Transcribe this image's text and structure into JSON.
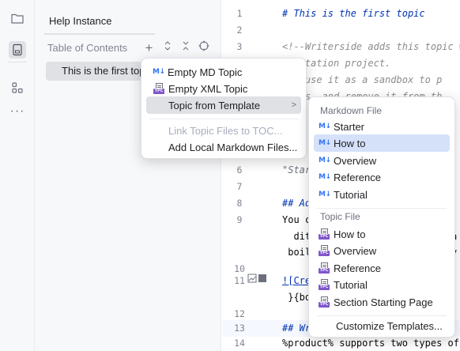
{
  "toolstrip": {
    "icons": [
      "folder-icon",
      "documents-icon",
      "structure-icon",
      "more-icon"
    ],
    "more_label": "···"
  },
  "panel": {
    "title": "Help Instance",
    "toc_label": "Table of Contents",
    "actions": {
      "add": "+",
      "expand": "⌃",
      "collapse": "✕",
      "locate": "⊕"
    },
    "selected_topic": "This is the first top"
  },
  "editor": {
    "lines": [
      {
        "n": "1",
        "t": "# This is the first topic"
      },
      {
        "n": "2",
        "t": ""
      },
      {
        "n": "3",
        "t": "<!--Writerside adds this topic w"
      },
      {
        "n": "",
        "t": "umentation project."
      },
      {
        "n": "",
        "t": "can use it as a sandbox to p"
      },
      {
        "n": "",
        "t": "tures, and remove it from th"
      },
      {
        "n": "",
        "t": "u"
      },
      {
        "n": "",
        "t": "e"
      },
      {
        "n": "6",
        "t": "\"Star"
      },
      {
        "n": "7",
        "t": ""
      },
      {
        "n": "8",
        "t": "## Ad"
      },
      {
        "n": "9",
        "t": "You c"
      },
      {
        "n": "",
        "t": "  dit"
      },
      {
        "n": "",
        "t": " boil"
      },
      {
        "n": "10",
        "t": ""
      },
      {
        "n": "11",
        "t": "![Cre"
      },
      {
        "n": "",
        "t": " }{bo"
      },
      {
        "n": "12",
        "t": ""
      },
      {
        "n": "13",
        "t": "## Wr"
      },
      {
        "n": "14",
        "t": "%product% supports two types of"
      }
    ],
    "right_edge": [
      ")",
      "a",
      "y"
    ]
  },
  "menu1": {
    "items": [
      {
        "label": "Empty MD Topic",
        "icon": "markdown-icon",
        "enabled": true
      },
      {
        "label": "Empty XML Topic",
        "icon": "tpc-icon",
        "enabled": true
      },
      {
        "label": "Topic from Template",
        "icon": "",
        "enabled": true,
        "submenu": true
      },
      {
        "label": "Link Topic Files to TOC...",
        "icon": "",
        "enabled": false
      },
      {
        "label": "Add Local Markdown Files...",
        "icon": "",
        "enabled": true
      }
    ],
    "submenu_arrow": ">"
  },
  "menu2": {
    "markdown_header": "Markdown File",
    "markdown_items": [
      "Starter",
      "How to",
      "Overview",
      "Reference",
      "Tutorial"
    ],
    "topic_header": "Topic File",
    "topic_items": [
      "How to",
      "Overview",
      "Reference",
      "Tutorial",
      "Section Starting Page"
    ],
    "customize": "Customize Templates...",
    "selected": "How to"
  },
  "icons": {
    "md": "M↓",
    "tpc": "TPC"
  },
  "colors": {
    "accent": "#3574f0",
    "selection": "#d5e1f9",
    "heading": "#0033b3",
    "comment": "#8c8c8c"
  }
}
